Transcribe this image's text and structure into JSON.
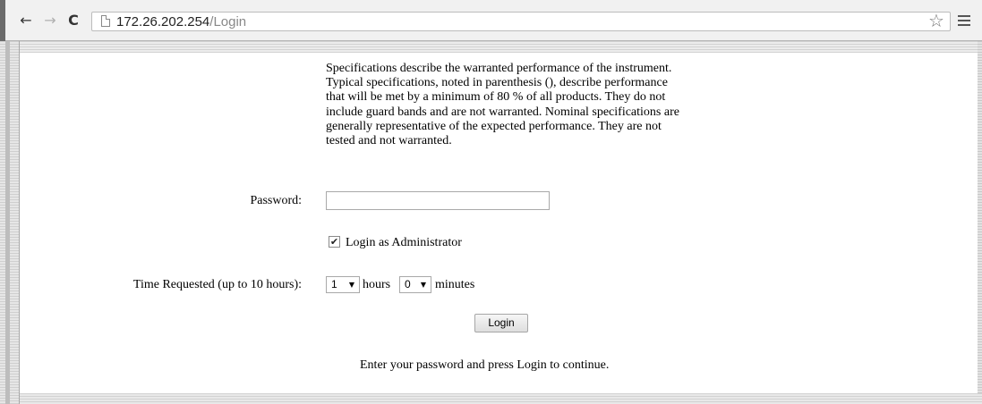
{
  "browser": {
    "url_host": "172.26.202.254",
    "url_path": "/Login",
    "icons": [
      "back-arrow-icon",
      "forward-arrow-icon",
      "reload-icon",
      "page-icon",
      "star-icon",
      "menu-icon"
    ]
  },
  "page": {
    "spec_text": "Specifications describe the warranted performance of the instrument. Typical specifications, noted in parenthesis (), describe performance that will be met by a minimum of 80 % of all products. They do not include guard bands and are not warranted. Nominal specifications are generally representative of the expected performance. They are not tested and not warranted.",
    "password_label": "Password:",
    "password_value": "",
    "admin_checkbox_checked": true,
    "admin_label": "Login as Administrator",
    "time_label": "Time Requested (up to 10 hours):",
    "hours_value": "1",
    "hours_text": "hours",
    "minutes_value": "0",
    "minutes_text": "minutes",
    "login_button": "Login",
    "hint": "Enter your password and press Login to continue."
  }
}
